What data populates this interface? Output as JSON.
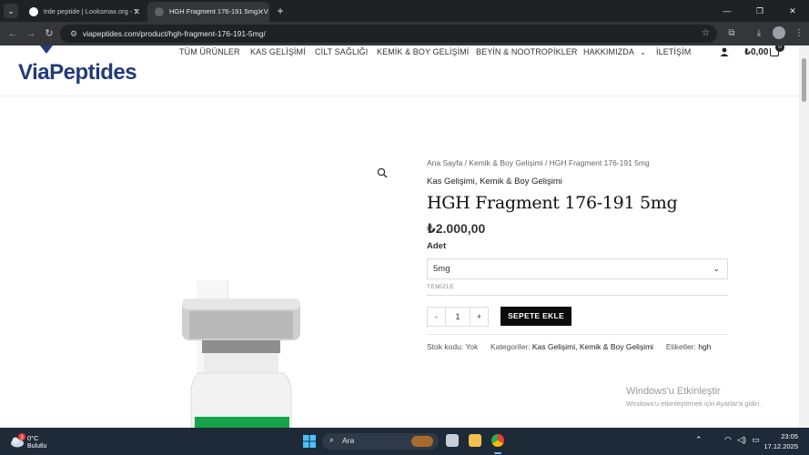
{
  "browser": {
    "tabs": [
      {
        "title": "trde peptide | Looksmax.org - T",
        "active": false
      },
      {
        "title": "HGH Fragment 176-191 5mg - V",
        "active": true
      }
    ],
    "url": "viapeptides.com/product/hgh-fragment-176-191-5mg/",
    "new_tab_label": "+"
  },
  "site": {
    "logo_text": "ViaPeptides",
    "nav": [
      "TÜM ÜRÜNLER",
      "KAS GELİŞİMİ",
      "CİLT SAĞLIĞI",
      "KEMİK & BOY GELİŞİMİ",
      "BEYİN & NOOTROPİKLER",
      "HAKKIMIZDA",
      "İLETİŞİM"
    ],
    "cart_total": "₺0,00",
    "cart_count": "0"
  },
  "product": {
    "breadcrumb": "Ana Sayfa / Kemik & Boy Gelişimi / HGH Fragment 176-191 5mg",
    "categories_line": "Kas Gelişimi, Kemik & Boy Gelişimi",
    "title": "HGH Fragment 176-191 5mg",
    "price": "₺2.000,00",
    "quantity_label": "Adet",
    "variant_selected": "5mg",
    "clear_label": "TEMİZLE",
    "qty_minus": "-",
    "qty_value": "1",
    "qty_plus": "+",
    "add_to_cart_label": "SEPETE EKLE",
    "meta": {
      "sku_label": "Stok kodu:",
      "sku_value": "Yok",
      "categories_label": "Kategoriler:",
      "categories_value": "Kas Gelişimi, Kemik & Boy Gelişimi",
      "tags_label": "Etiketler:",
      "tags_value": "hgh"
    }
  },
  "watermark": {
    "line1": "Windows'u Etkinleştir",
    "line2": "Windows'u etkinleştirmek için Ayarlar'a gidin."
  },
  "taskbar": {
    "weather_temp": "0°C",
    "weather_cond": "Bulutlu",
    "weather_badge": "3",
    "search_placeholder": "Ara",
    "time": "23:05",
    "date": "17.12.2025"
  },
  "colors": {
    "brand": "#233a7a",
    "button": "#0b0b0b",
    "chrome_dark": "#202124",
    "taskbar": "#1f2a38"
  }
}
